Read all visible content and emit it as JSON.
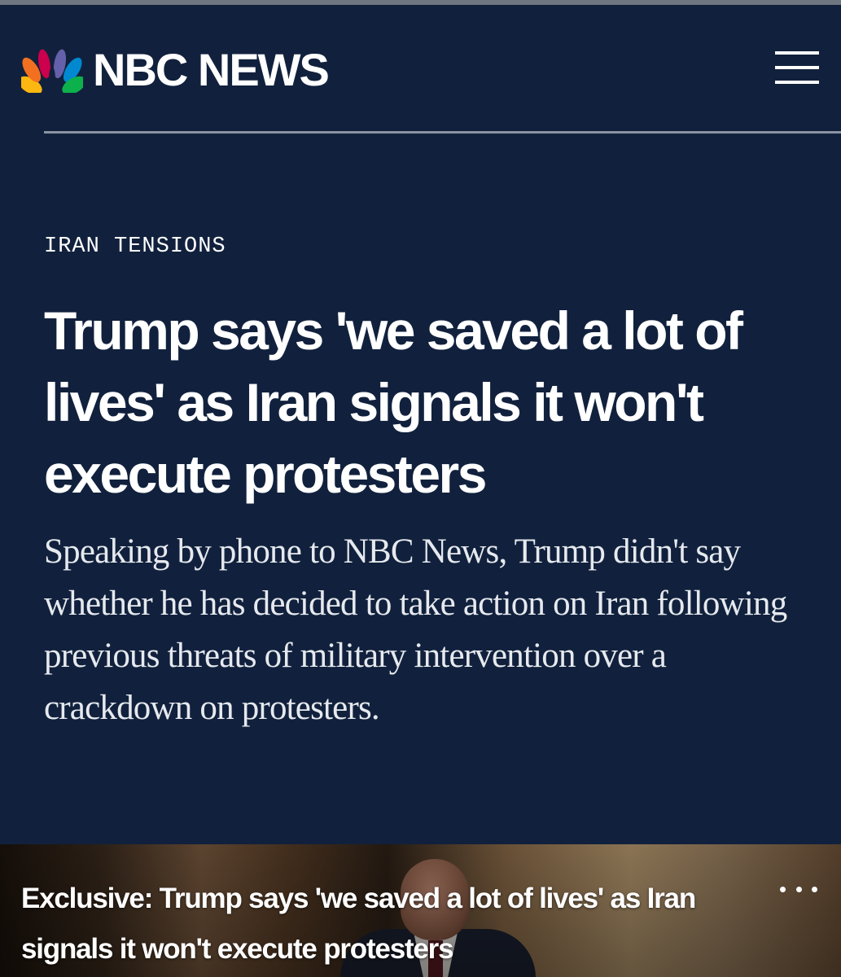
{
  "header": {
    "brand": "NBC NEWS",
    "logo_icon": "nbc-peacock-icon",
    "menu_icon": "hamburger-menu-icon"
  },
  "article": {
    "kicker": "IRAN TENSIONS",
    "headline": "Trump says 'we saved a lot of lives' as Iran signals it won't execute protesters",
    "dek": "Speaking by phone to NBC News, Trump didn't say whether he has decided to take action on Iran following previous threats of military intervention over a crackdown on protesters."
  },
  "video": {
    "title": "Exclusive: Trump says 'we saved a lot of lives' as Iran signals it won't execute protesters",
    "more_icon": "more-options-icon"
  },
  "colors": {
    "background": "#11213d",
    "text": "#ffffff",
    "rule": "#8a93a3",
    "peacock": [
      "#fcb711",
      "#f37021",
      "#cc004c",
      "#6460aa",
      "#0089d0",
      "#0db14b"
    ]
  }
}
